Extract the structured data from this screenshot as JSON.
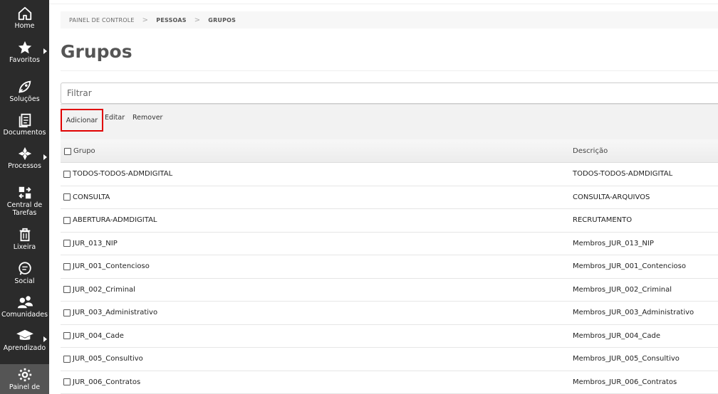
{
  "sidebar": {
    "items": [
      {
        "label": "Home",
        "icon": "home-icon"
      },
      {
        "label": "Favoritos",
        "icon": "star-icon"
      },
      {
        "label": "Soluções",
        "icon": "rocket-icon"
      },
      {
        "label": "Documentos",
        "icon": "documents-icon"
      },
      {
        "label": "Processos",
        "icon": "workflow-icon"
      },
      {
        "label": "Central de Tarefas",
        "icon": "tasks-icon"
      },
      {
        "label": "Lixeira",
        "icon": "trash-icon"
      },
      {
        "label": "Social",
        "icon": "chat-icon"
      },
      {
        "label": "Comunidades",
        "icon": "community-icon"
      },
      {
        "label": "Aprendizado",
        "icon": "graduation-cap-icon"
      },
      {
        "label": "Painel de",
        "icon": "gear-icon"
      }
    ]
  },
  "breadcrumb": [
    "PAINEL DE CONTROLE",
    "PESSOAS",
    "GRUPOS"
  ],
  "page": {
    "title": "Grupos"
  },
  "filter": {
    "placeholder": "Filtrar",
    "value": ""
  },
  "toolbar": {
    "add_label": "Adicionar",
    "edit_label": "Editar",
    "remove_label": "Remover"
  },
  "table": {
    "headers": [
      "Grupo",
      "Descrição"
    ],
    "rows": [
      {
        "group": "TODOS-TODOS-ADMDIGITAL",
        "description": "TODOS-TODOS-ADMDIGITAL"
      },
      {
        "group": "CONSULTA",
        "description": "CONSULTA-ARQUIVOS"
      },
      {
        "group": "ABERTURA-ADMDIGITAL",
        "description": "RECRUTAMENTO"
      },
      {
        "group": "JUR_013_NIP",
        "description": "Membros_JUR_013_NIP"
      },
      {
        "group": "JUR_001_Contencioso",
        "description": "Membros_JUR_001_Contencioso"
      },
      {
        "group": "JUR_002_Criminal",
        "description": "Membros_JUR_002_Criminal"
      },
      {
        "group": "JUR_003_Administrativo",
        "description": "Membros_JUR_003_Administrativo"
      },
      {
        "group": "JUR_004_Cade",
        "description": "Membros_JUR_004_Cade"
      },
      {
        "group": "JUR_005_Consultivo",
        "description": "Membros_JUR_005_Consultivo"
      },
      {
        "group": "JUR_006_Contratos",
        "description": "Membros_JUR_006_Contratos"
      }
    ]
  }
}
